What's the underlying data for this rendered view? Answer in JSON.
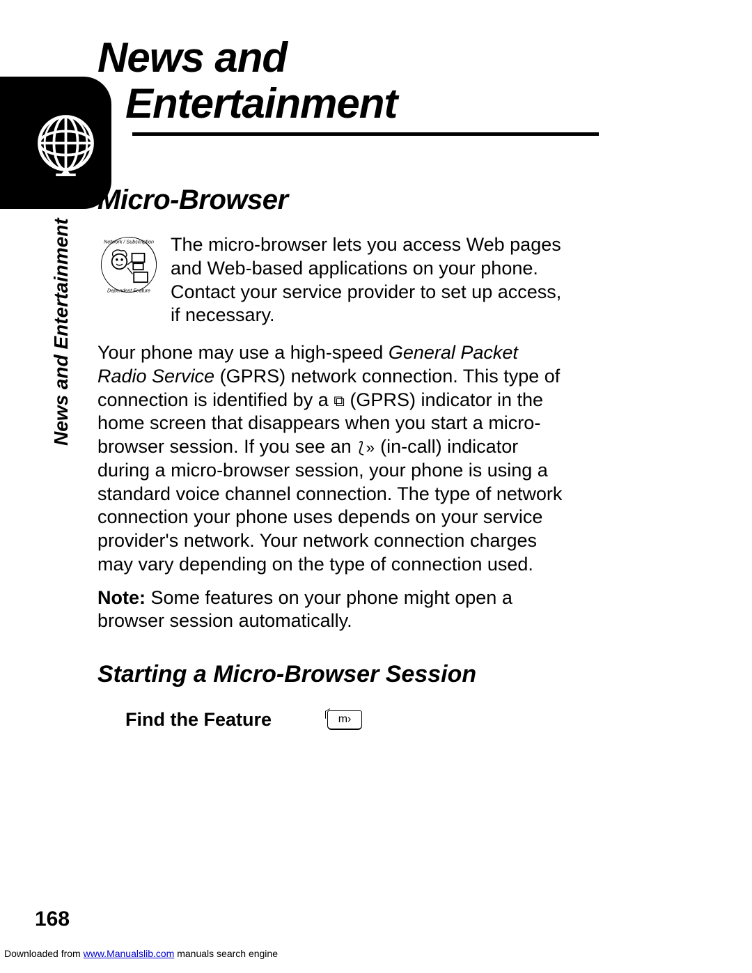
{
  "chapter": {
    "title_line1": "News and",
    "title_line2": "Entertainment"
  },
  "side_label": "News and Entertainment",
  "section": {
    "heading": "Micro-Browser",
    "intro": "The micro-browser lets you access Web pages and Web-based applications on your phone. Contact your service provider to set up access, if necessary.",
    "para2_a": "Your phone may use a high-speed ",
    "para2_italic": "General Packet Radio Service",
    "para2_b": " (GPRS) network connection. This type of connection is identified by a ",
    "gprs_icon": "⧉",
    "para2_c": " (GPRS) indicator in the home screen that disappears when you start a micro-browser session. If you see an ",
    "incall_icon": "⟅»",
    "para2_d": " (in-call) indicator during a micro-browser session, your phone is using a standard voice channel connection. The type of network connection your phone uses depends on your service provider's network. Your network connection charges may vary depending on the type of connection used.",
    "note_label": "Note:",
    "note_text": " Some features on your phone might open a browser session automatically."
  },
  "subsection": {
    "heading": "Starting a Micro-Browser Session",
    "find_feature": "Find the Feature",
    "softkey_label": "m›"
  },
  "page_number": "168",
  "footer": {
    "prefix": "Downloaded from ",
    "link_text": "www.Manualslib.com",
    "link_href": "#",
    "suffix": " manuals search engine"
  }
}
